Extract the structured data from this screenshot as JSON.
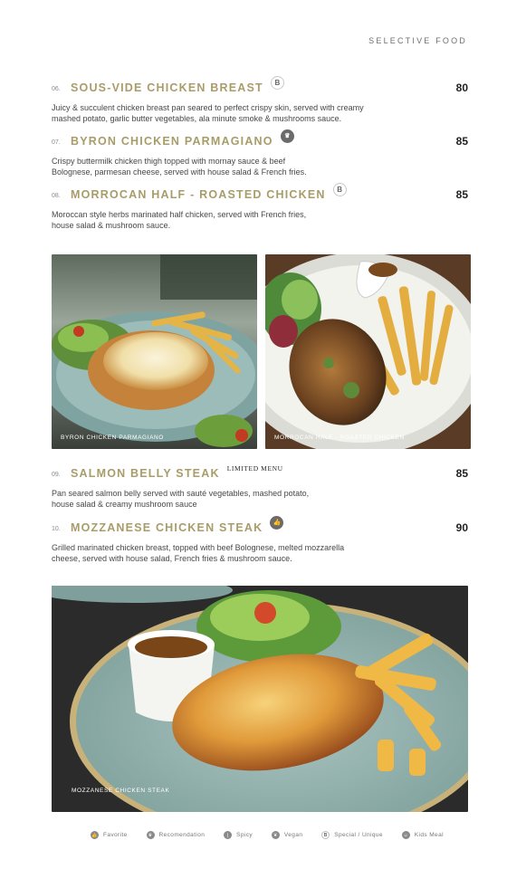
{
  "header": {
    "section": "SELECTIVE FOOD"
  },
  "items": [
    {
      "num": "06.",
      "name": "SOUS-VIDE CHICKEN BREAST",
      "badge": "B",
      "price": "80",
      "desc_lines": [
        "Juicy & succulent chicken breast pan seared to perfect crispy skin, served with creamy",
        "mashed potato, garlic butter vegetables, ala minute smoke & mushrooms sauce."
      ]
    },
    {
      "num": "07.",
      "name": "BYRON CHICKEN PARMAGIANO",
      "badge": "♛",
      "price": "85",
      "desc_lines": [
        "Crispy buttermilk chicken thigh topped with mornay sauce & beef",
        "Bolognese, parmesan cheese, served with house salad & French fries."
      ]
    },
    {
      "num": "08.",
      "name": "MORROCAN HALF - ROASTED CHICKEN",
      "badge": "B",
      "price": "85",
      "desc_lines": [
        "Moroccan style herbs marinated half chicken, served with French fries,",
        "house salad & mushroom sauce."
      ]
    },
    {
      "num": "09.",
      "name": "SALMON BELLY STEAK",
      "tag": "LIMITED MENU",
      "price": "85",
      "desc_lines": [
        "Pan seared salmon belly served with sauté vegetables, mashed potato,",
        "house salad & creamy mushroom sauce"
      ]
    },
    {
      "num": "10.",
      "name": "MOZZANESE CHICKEN STEAK",
      "badge": "👍",
      "price": "90",
      "desc_lines": [
        "Grilled marinated chicken breast, topped with beef Bolognese, melted mozzarella",
        "cheese, served with house salad, French fries & mushroom sauce."
      ]
    }
  ],
  "photos": [
    {
      "caption": "BYRON CHICKEN PARMAGIANO"
    },
    {
      "caption": "MORROCAN HALF - ROASTED CHICKEN"
    },
    {
      "caption": "MOZZANESE CHICKEN STEAK"
    }
  ],
  "legend": [
    {
      "icon": "thumbs-up-icon",
      "glyph": "👍",
      "label": "Favorite"
    },
    {
      "icon": "crown-icon",
      "glyph": "♛",
      "label": "Recomendation"
    },
    {
      "icon": "chili-icon",
      "glyph": "❘",
      "label": "Spicy"
    },
    {
      "icon": "leaf-icon",
      "glyph": "❦",
      "label": "Vegan"
    },
    {
      "icon": "b-icon",
      "glyph": "B",
      "label": "Special / Unique"
    },
    {
      "icon": "kids-icon",
      "glyph": "☺",
      "label": "Kids Meal"
    }
  ],
  "colors": {
    "dish_name": "#a89c68",
    "plate": "#8fb0ad",
    "background": "#ffffff"
  }
}
